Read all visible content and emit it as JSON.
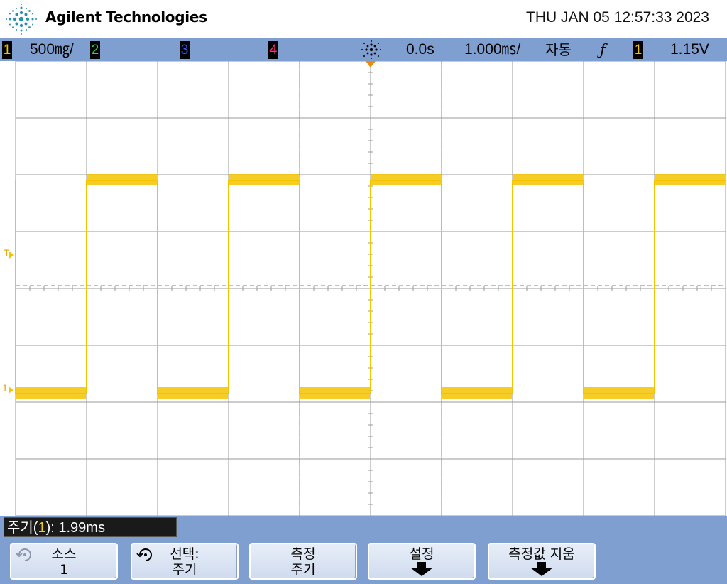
{
  "header": {
    "brand": "Agilent Technologies",
    "datetime": "THU JAN 05 12:57:33 2023"
  },
  "status": {
    "ch1_num": "1",
    "ch1_scale": "500㎎/",
    "ch2_num": "2",
    "ch3_num": "3",
    "ch4_num": "4",
    "time_delay": "0.0s",
    "time_scale": "1.000㎳/",
    "trigger_mode": "자동",
    "trigger_slope_symbol": "ƒ",
    "trigger_source": "1",
    "trigger_level": "1.15V"
  },
  "screen": {
    "trigger_marker": "T",
    "ground_marker": "1"
  },
  "measurement": {
    "prefix": "주기(",
    "channel": "1",
    "suffix": "): 1.99ms"
  },
  "softkeys": [
    {
      "line1": "소스",
      "line2": "1"
    },
    {
      "line1": "선택:",
      "line2": "주기"
    },
    {
      "line1": "측정",
      "line2": "주기"
    },
    {
      "line1": "설정",
      "line2": ""
    },
    {
      "line1": "측정값 지움",
      "line2": ""
    }
  ],
  "colors": {
    "ch1": "#f5c400",
    "ch2": "#33cc33",
    "ch3": "#3a5bff",
    "ch4": "#ff2d7a",
    "marker": "#e88a1a",
    "panel": "#7f9fd0"
  },
  "waveform": {
    "type": "square",
    "period_divisions": 2,
    "low_level_divisions": -1.85,
    "high_level_divisions": 1.9,
    "trigger_level_divisions": 0.05,
    "trigger_offset_divisions": 0.55
  }
}
